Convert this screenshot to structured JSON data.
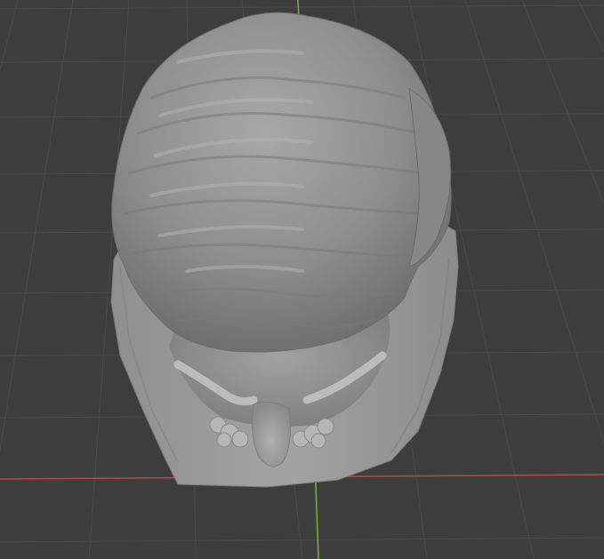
{
  "viewport": {
    "view": "3D Viewport",
    "background_color": "#3d3d3d",
    "grid_color": "#4a4a4a",
    "x_axis_color": "#b34a4d",
    "y_axis_color": "#7fae2f",
    "model": {
      "name": "sculpted-head-bust",
      "shading": "solid",
      "base_color": "#9a9a9a"
    }
  }
}
